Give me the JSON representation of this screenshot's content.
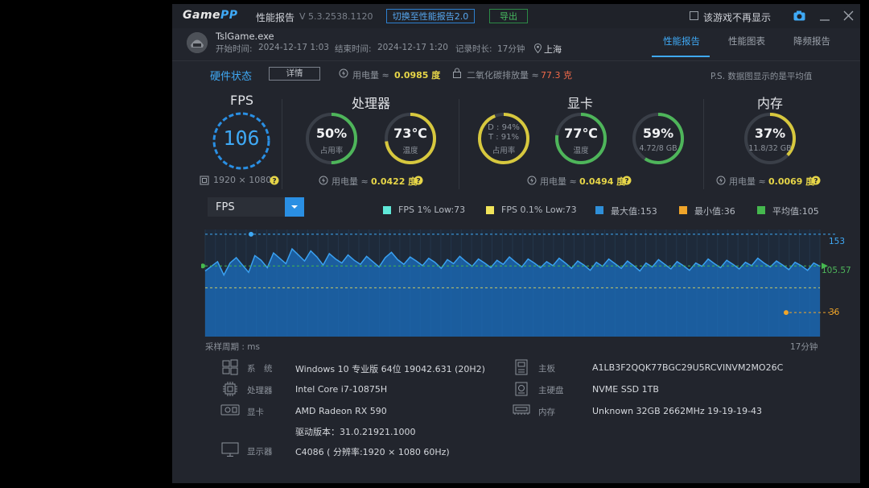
{
  "titlebar": {
    "logo_main": "Game",
    "logo_accent": "PP",
    "title": "性能报告",
    "version": "V 5.3.2538.1120",
    "switch_btn": "切换至性能报告2.0",
    "export_btn": "导出",
    "no_show": "该游戏不再显示"
  },
  "header": {
    "game": "TslGame.exe",
    "start_label": "开始时间:",
    "start_time": "2024-12-17 1:03",
    "end_label": "结束时间:",
    "end_time": "2024-12-17 1:20",
    "duration_label": "记录时长:",
    "duration": "17分钟",
    "location": "上海",
    "tabs": [
      "性能报告",
      "性能图表",
      "降频报告"
    ]
  },
  "status": {
    "title": "硬件状态",
    "detail": "详情",
    "power_label": "用电量 ≈",
    "power_value": "0.0985 度",
    "co2_label": "二氧化碳排放量 ≈",
    "co2_value": "77.3 克",
    "note": "P.S. 数据图显示的是平均值"
  },
  "fps": {
    "heading": "FPS",
    "value": "106",
    "resolution": "1920 × 1080"
  },
  "cpu": {
    "heading": "处理器",
    "usage_value": "50%",
    "usage_label": "占用率",
    "usage_level": 0.5,
    "temp_value": "73℃",
    "temp_label": "温度",
    "temp_level": 0.73,
    "power_label": "用电量 ≈",
    "power_value": "0.0422 度"
  },
  "gpu": {
    "heading": "显卡",
    "d_label": "D : 94%",
    "t_label": "T : 91%",
    "usage_label": "占用率",
    "usage_level": 0.94,
    "temp_value": "77℃",
    "temp_label": "温度",
    "temp_level": 0.77,
    "mem_value": "59%",
    "mem_label": "4.72/8 GB",
    "mem_level": 0.59,
    "power_label": "用电量 ≈",
    "power_value": "0.0494 度"
  },
  "ram": {
    "heading": "内存",
    "value": "37%",
    "label": "11.8/32 GB",
    "level": 0.37,
    "power_label": "用电量 ≈",
    "power_value": "0.0069 度"
  },
  "chart": {
    "selector": "FPS",
    "legend": [
      {
        "label": "FPS 1% Low:73",
        "color": "#5fe8d8"
      },
      {
        "label": "FPS 0.1% Low:73",
        "color": "#f1e45a"
      },
      {
        "label": "最大值:153",
        "color": "#2f8fd8"
      },
      {
        "label": "最小值:36",
        "color": "#f0a52a"
      },
      {
        "label": "平均值:105",
        "color": "#45b84e"
      }
    ],
    "max_label": "153",
    "avg_label": "105.57",
    "min_label": "36",
    "x_left": "采样周期 : ms",
    "x_right": "17分钟"
  },
  "chart_data": {
    "type": "area",
    "series": [
      {
        "name": "FPS",
        "values": [
          98,
          105,
          112,
          92,
          110,
          118,
          107,
          96,
          121,
          114,
          103,
          125,
          117,
          109,
          131,
          122,
          113,
          128,
          119,
          107,
          124,
          116,
          110,
          122,
          114,
          108,
          120,
          112,
          104,
          118,
          126,
          115,
          108,
          119,
          113,
          106,
          117,
          111,
          102,
          115,
          109,
          120,
          112,
          105,
          116,
          110,
          103,
          114,
          108,
          119,
          111,
          104,
          116,
          110,
          103,
          112,
          106,
          117,
          110,
          102,
          113,
          107,
          99,
          111,
          105,
          116,
          109,
          102,
          113,
          106,
          98,
          110,
          104,
          115,
          108,
          101,
          112,
          106,
          99,
          110,
          105,
          116,
          109,
          103,
          114,
          108,
          101,
          111,
          106,
          117,
          110,
          104,
          113,
          107,
          100,
          111,
          106,
          99,
          110,
          105
        ]
      }
    ],
    "max": 153,
    "min": 36,
    "avg": 105.57,
    "ylim": [
      0,
      160
    ]
  },
  "system": [
    {
      "label": "系　统",
      "value": "Windows 10 专业版 64位 19042.631 (20H2)",
      "icon": "windows-icon"
    },
    {
      "label": "处理器",
      "value": "Intel Core i7-10875H",
      "icon": "cpu-icon"
    },
    {
      "label": "显卡",
      "value": "AMD Radeon RX 590",
      "extra": "驱动版本：31.0.21921.1000",
      "icon": "gpu-icon"
    },
    {
      "label": "显示器",
      "value": "C4086 ( 分辨率:1920 × 1080 60Hz)",
      "icon": "monitor-icon"
    },
    {
      "label": "主板",
      "value": "A1LB3F2QQK77BGC29U5RCVINVM2MO26C",
      "icon": "motherboard-icon"
    },
    {
      "label": "主硬盘",
      "value": "NVME SSD 1TB",
      "icon": "disk-icon"
    },
    {
      "label": "内存",
      "value": "Unknown 32GB 2662MHz 19-19-19-43",
      "icon": "ram-icon"
    }
  ]
}
